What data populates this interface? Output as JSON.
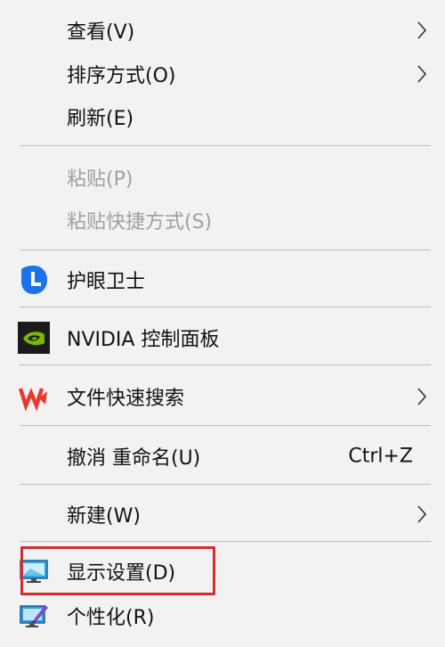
{
  "context_menu": {
    "items": [
      {
        "label": "查看(V)",
        "submenu": true,
        "disabled": false
      },
      {
        "label": "排序方式(O)",
        "submenu": true,
        "disabled": false
      },
      {
        "label": "刷新(E)",
        "submenu": false,
        "disabled": false
      },
      {
        "label": "粘贴(P)",
        "submenu": false,
        "disabled": true
      },
      {
        "label": "粘贴快捷方式(S)",
        "submenu": false,
        "disabled": true
      },
      {
        "label": "护眼卫士",
        "icon": "eye-guard-icon",
        "submenu": false,
        "disabled": false
      },
      {
        "label": "NVIDIA 控制面板",
        "icon": "nvidia-icon",
        "submenu": false,
        "disabled": false
      },
      {
        "label": "文件快速搜索",
        "icon": "wps-icon",
        "submenu": true,
        "disabled": false
      },
      {
        "label": "撤消 重命名(U)",
        "shortcut": "Ctrl+Z",
        "submenu": false,
        "disabled": false
      },
      {
        "label": "新建(W)",
        "submenu": true,
        "disabled": false
      },
      {
        "label": "显示设置(D)",
        "icon": "display-settings-icon",
        "submenu": false,
        "disabled": false,
        "highlighted": true
      },
      {
        "label": "个性化(R)",
        "icon": "personalize-icon",
        "submenu": false,
        "disabled": false
      }
    ]
  },
  "colors": {
    "menu_background": "#f2f2f2",
    "separator": "#bdbdbd",
    "disabled_text": "#a0a0a0",
    "highlight_border": "#d32d2f",
    "nvidia_green": "#76b900",
    "wps_red": "#e8382f",
    "eye_guard_blue": "#1a73e8"
  }
}
